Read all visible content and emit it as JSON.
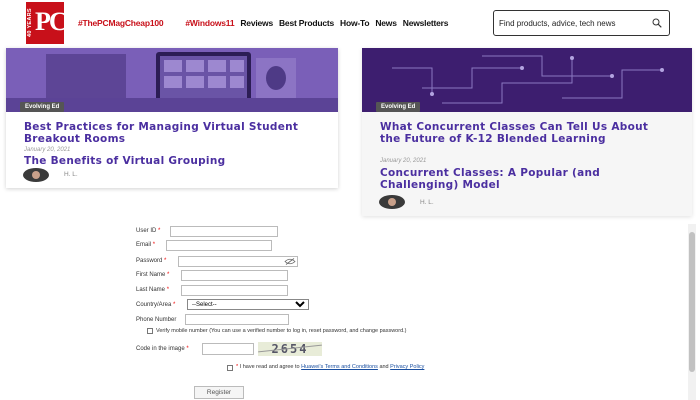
{
  "header": {
    "logo": {
      "mark": "PC",
      "side_text": "40 YEARS"
    },
    "nav": {
      "hashtag1": "#ThePCMagCheap100",
      "hashtag2": "#Windows11",
      "items": [
        "Reviews",
        "Best Products",
        "How-To",
        "News",
        "Newsletters"
      ]
    },
    "search": {
      "placeholder": "Find products, advice, tech news",
      "icon": "search-icon"
    }
  },
  "cards": [
    {
      "tag": "Evolving Ed",
      "title": "Best Practices for Managing Virtual Student Breakout Rooms",
      "date": "January 20, 2021",
      "subtitle": "The Benefits of Virtual Grouping",
      "author": "H. L."
    },
    {
      "tag": "Evolving Ed",
      "title": "What Concurrent Classes Can Tell Us About the Future of K-12 Blended Learning",
      "date": "January 20, 2021",
      "subtitle": "Concurrent Classes: A Popular (and Challenging) Model",
      "author": "H. L."
    }
  ],
  "form": {
    "user_id_label": "User ID",
    "email_label": "Email",
    "password_label": "Password",
    "first_name_label": "First Name",
    "last_name_label": "Last Name",
    "country_label": "Country/Area",
    "country_selected": "--Select--",
    "phone_label": "Phone Number",
    "verify_note": "Verify mobile number (You can use a verified number to log in, reset password, and change password.)",
    "code_label": "Code in the image",
    "captcha_text": "2654",
    "agree_prefix": "I have read and agree to",
    "agree_link1": "Huawei's Terms and Conditions",
    "agree_and": "and",
    "agree_link2": "Privacy Policy",
    "register_label": "Register",
    "required_mark": "*"
  },
  "colors": {
    "brand_red": "#c8101a",
    "title_purple": "#4b2fa0",
    "link_blue": "#1a4fa0"
  }
}
